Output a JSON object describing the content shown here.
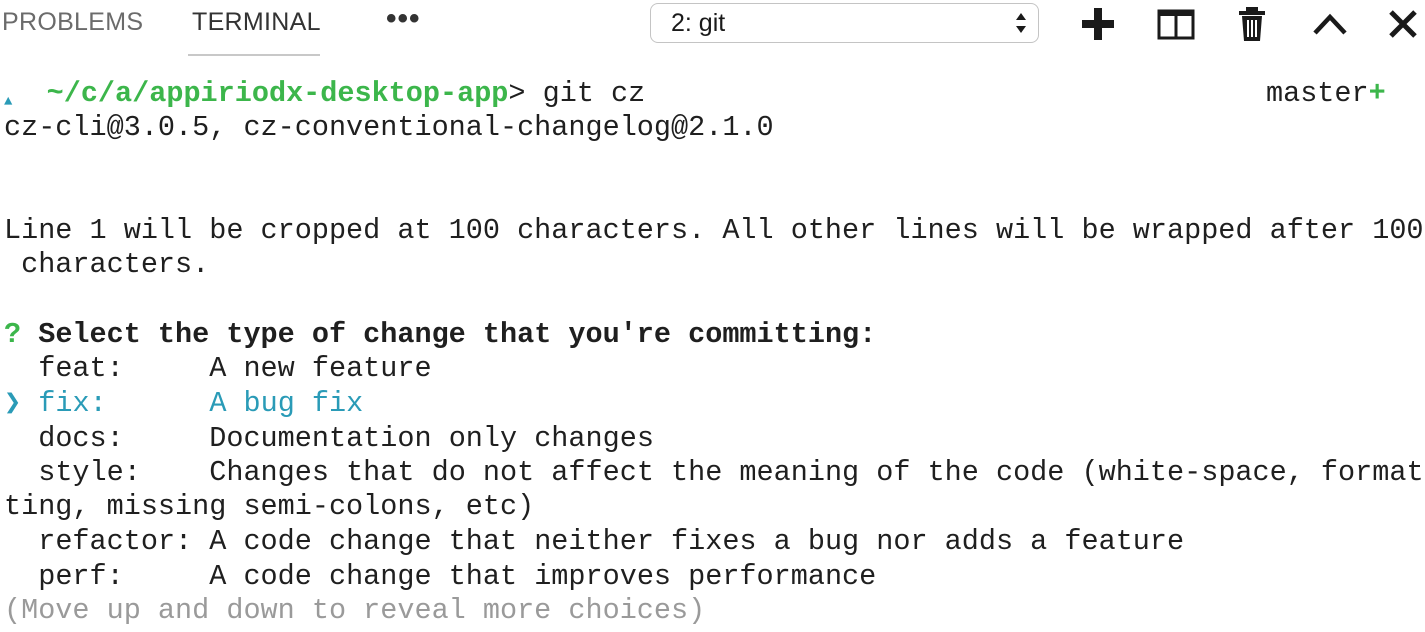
{
  "panel": {
    "tabs": [
      "PROBLEMS",
      "TERMINAL"
    ],
    "active_tab": "TERMINAL",
    "more_label": "•••",
    "terminal_selector": {
      "selected": "2: git"
    },
    "actions": {
      "new_terminal_icon": "plus-icon",
      "split_icon": "split-editor-icon",
      "kill_icon": "trash-icon",
      "maximize_icon": "chevron-up-icon",
      "close_icon": "close-icon"
    }
  },
  "terminal": {
    "prompt_marker": "▲",
    "cwd": "~/c/a/appiriodx-desktop-app",
    "prompt_symbol": ">",
    "command": " git cz",
    "branch": "master",
    "branch_dirty": "+",
    "version_line": "cz-cli@3.0.5, cz-conventional-changelog@2.1.0",
    "info_line_1": "Line 1 will be cropped at 100 characters. All other lines will be wrapped after 100",
    "info_line_2": " characters.",
    "question_mark": "?",
    "question": " Select the type of change that you're committing:",
    "pointer": "❯",
    "choices": [
      {
        "key": "feat:     ",
        "desc": "A new feature",
        "selected": false
      },
      {
        "key": "fix:      ",
        "desc": "A bug fix",
        "selected": true
      },
      {
        "key": "docs:     ",
        "desc": "Documentation only changes",
        "selected": false
      },
      {
        "key": "style:    ",
        "desc": "Changes that do not affect the meaning of the code (white-space, format",
        "selected": false
      },
      {
        "key": "refactor: ",
        "desc": "A code change that neither fixes a bug nor adds a feature",
        "selected": false
      },
      {
        "key": "perf:     ",
        "desc": "A code change that improves performance",
        "selected": false
      }
    ],
    "style_wrap": "ting, missing semi-colons, etc)",
    "hint": "(Move up and down to reveal more choices)"
  },
  "colors": {
    "cwd_green": "#3cb64b",
    "selected_cyan": "#2a9bb7",
    "hint_gray": "#9a9a9a"
  }
}
